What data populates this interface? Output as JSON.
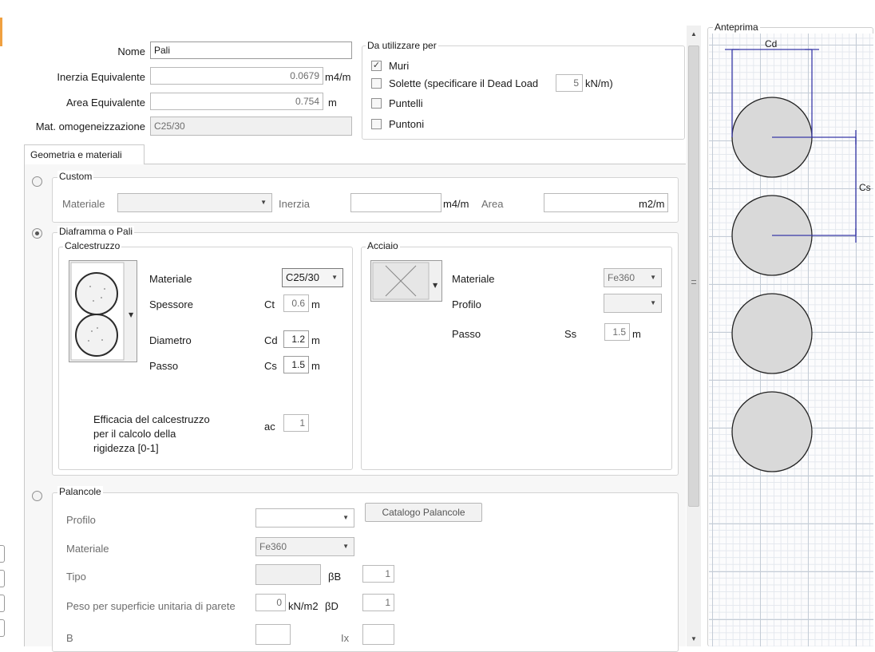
{
  "header": {
    "nome_label": "Nome",
    "nome_value": "Pali",
    "inerzia_label": "Inerzia Equivalente",
    "inerzia_value": "0.0679",
    "inerzia_unit": "m4/m",
    "area_label": "Area Equivalente",
    "area_value": "0.754",
    "area_unit": "m",
    "mat_label": "Mat. omogeneizzazione",
    "mat_value": "C25/30"
  },
  "usage": {
    "title": "Da utilizzare per",
    "muri": "Muri",
    "muri_checked": "✓",
    "solette": "Solette  (specificare il Dead Load",
    "dead_load": "5",
    "dead_load_unit": "kN/m)",
    "puntelli": "Puntelli",
    "puntoni": "Puntoni"
  },
  "tabs": {
    "geom": "Geometria e materiali"
  },
  "custom": {
    "title": "Custom",
    "materiale_label": "Materiale",
    "materiale_value": "",
    "inerzia_label": "Inerzia",
    "inerzia_unit": "m4/m",
    "area_label": "Area",
    "area_unit": "m2/m"
  },
  "diaframma": {
    "title": "Diaframma o Pali",
    "calcestruzzo": {
      "title": "Calcestruzzo",
      "materiale_label": "Materiale",
      "materiale_value": "C25/30",
      "spessore_label": "Spessore",
      "spessore_sym": "Ct",
      "spessore_value": "0.6",
      "spessore_unit": "m",
      "diametro_label": "Diametro",
      "diametro_sym": "Cd",
      "diametro_value": "1.2",
      "diametro_unit": "m",
      "passo_label": "Passo",
      "passo_sym": "Cs",
      "passo_value": "1.5",
      "passo_unit": "m",
      "efficacia_line1": "Efficacia del calcestruzzo",
      "efficacia_line2": "per il calcolo della",
      "efficacia_line3": "rigidezza  [0-1]",
      "efficacia_sym": "ac",
      "efficacia_value": "1"
    },
    "acciaio": {
      "title": "Acciaio",
      "materiale_label": "Materiale",
      "materiale_value": "Fe360",
      "profilo_label": "Profilo",
      "profilo_value": "",
      "passo_label": "Passo",
      "passo_sym": "Ss",
      "passo_value": "1.5",
      "passo_unit": "m"
    }
  },
  "palancole": {
    "title": "Palancole",
    "profilo_label": "Profilo",
    "profilo_value": "",
    "catalogo_button": "Catalogo Palancole",
    "materiale_label": "Materiale",
    "materiale_value": "Fe360",
    "tipo_label": "Tipo",
    "beta_b": "βB",
    "beta_b_value": "1",
    "peso_label": "Peso per superficie unitaria di parete",
    "peso_value": "0",
    "peso_unit": "kN/m2",
    "beta_d": "βD",
    "beta_d_value": "1",
    "b_label": "B",
    "ix_label": "Ix"
  },
  "preview": {
    "title": "Anteprima",
    "cd": "Cd",
    "cs": "Cs"
  },
  "colors": {
    "dimension_line": "#3a3aa8",
    "grid": "#dde3ea",
    "pile_fill": "#d8d8d8"
  }
}
